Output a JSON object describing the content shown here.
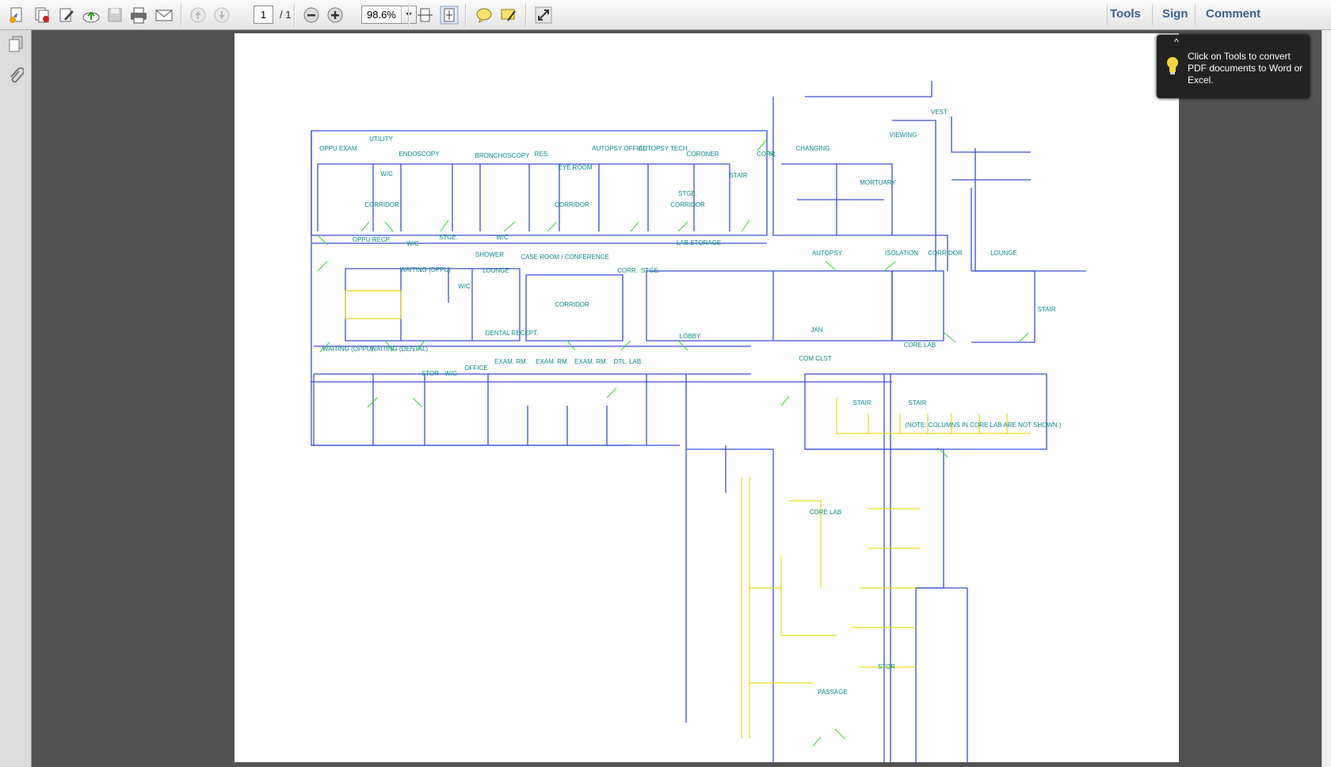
{
  "toolbar": {
    "page_current": "1",
    "page_total": "/ 1",
    "zoom": "98.6%",
    "right_links": [
      "Tools",
      "Sign",
      "Comment"
    ]
  },
  "tooltip": {
    "text": "Click on Tools to convert PDF documents to Word or Excel."
  },
  "floorplan": {
    "labels": [
      "OPPU EXAM.",
      "UTILITY",
      "W/C",
      "ENDOSCOPY",
      "BRONCHOSCOPY",
      "RES.",
      "EYE ROOM",
      "AUTOPSY OFFICE",
      "AUTOPSY TECH.",
      "CORONER",
      "STAIR",
      "CORR.",
      "CHANGING",
      "MORTUARY",
      "VIEWING",
      "VEST.",
      "CORRIDOR",
      "CORRIDOR",
      "STGE.",
      "CORRIDOR",
      "OPPU RECP.",
      "W/C",
      "STGE.",
      "W/C",
      "SHOWER",
      "WAITING (OPPU)",
      "LOUNGE",
      "W/C",
      "CASE ROOM / CONFERENCE",
      "CORR.",
      "STGE.",
      "LAB.STORAGE",
      "AUTOPSY",
      "ISOLATION",
      "CORRIDOR",
      "LOUNGE",
      "CORRIDOR",
      "STAIR",
      "WAITING (OPPU)",
      "WAITING (DENTAL)",
      "DENTAL RECEPT.",
      "STOR",
      "W/C",
      "OFFICE",
      "EXAM. RM.",
      "EXAM. RM.",
      "EXAM. RM.",
      "DTL. LAB.",
      "LOBBY",
      "JAN",
      "CORE LAB",
      "COM CLST",
      "STAIR",
      "STAIR",
      "(NOTE: COLUMNS IN CORE LAB ARE NOT SHOWN.)",
      "CORE LAB",
      "STOR",
      "PASSAGE"
    ]
  },
  "colors": {
    "wall": "#3a4fd0",
    "door": "#39d23a",
    "label": "#0a8a8a",
    "fixture": "#e6dc1e",
    "link": "#3d5f8a"
  }
}
